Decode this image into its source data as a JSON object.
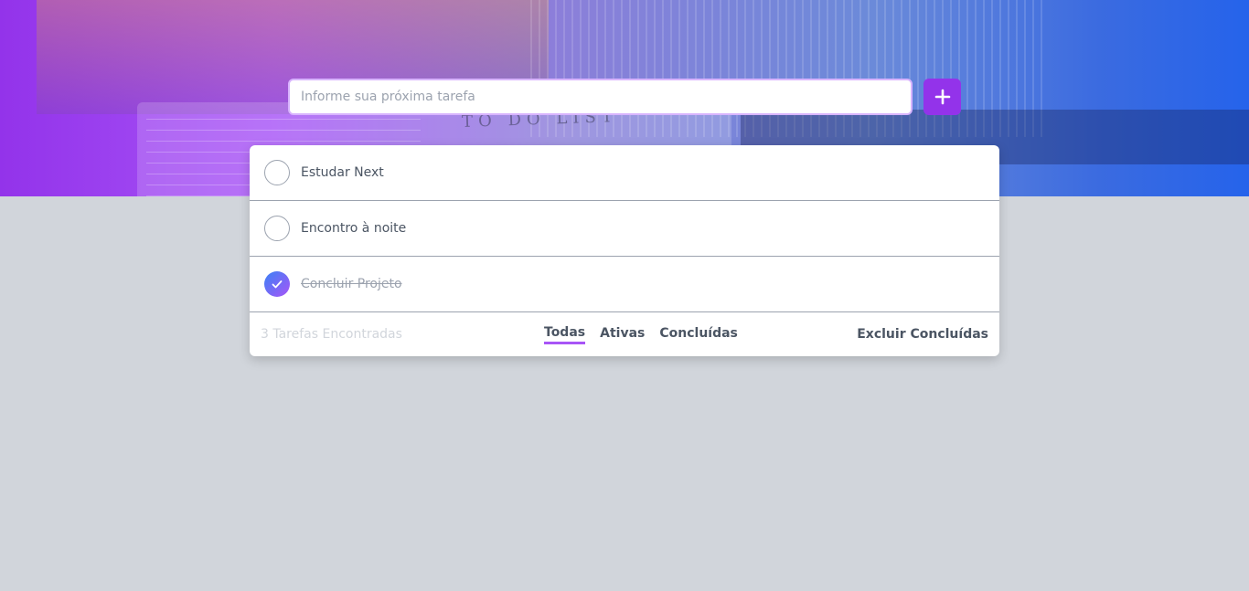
{
  "hero": {
    "handwriting": "TO DO LIST"
  },
  "new_task": {
    "placeholder": "Informe sua próxima tarefa",
    "value": "",
    "add_icon": "plus-icon"
  },
  "tasks": [
    {
      "label": "Estudar Next",
      "completed": false
    },
    {
      "label": "Encontro à noite",
      "completed": false
    },
    {
      "label": "Concluir Projeto",
      "completed": true
    }
  ],
  "footer": {
    "count": "3 Tarefas Encontradas",
    "filters": [
      {
        "label": "Todas",
        "active": true
      },
      {
        "label": "Ativas",
        "active": false
      },
      {
        "label": "Concluídas",
        "active": false
      }
    ],
    "clear_label": "Excluir Concluídas"
  },
  "colors": {
    "accent": "#9333ea",
    "gradient_start": "#9333ea",
    "gradient_end": "#2563eb",
    "background": "#d1d5db"
  }
}
